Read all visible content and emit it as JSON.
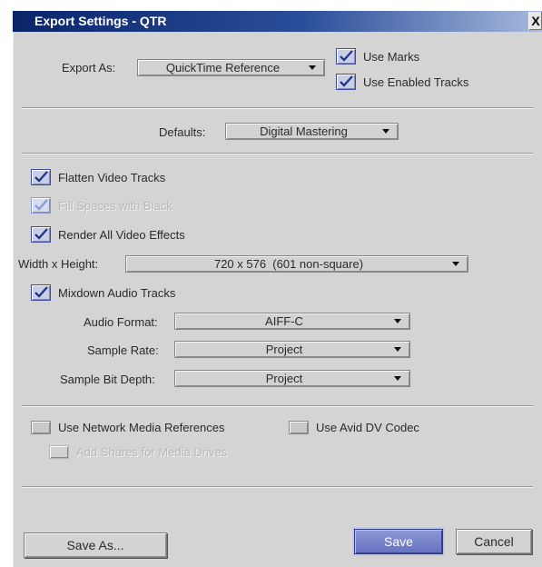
{
  "window": {
    "title": "Export Settings - QTR",
    "close_label": "X"
  },
  "top": {
    "export_as_label": "Export As:",
    "export_as_value": "QuickTime Reference",
    "use_marks": {
      "label": "Use Marks",
      "checked": true
    },
    "use_enabled_tracks": {
      "label": "Use Enabled Tracks",
      "checked": true
    }
  },
  "defaults": {
    "label": "Defaults:",
    "value": "Digital Mastering"
  },
  "video": {
    "flatten": {
      "label": "Flatten Video Tracks",
      "checked": true
    },
    "fill_spaces": {
      "label": "Fill Spaces with Black",
      "checked": true,
      "enabled": false
    },
    "render_effects": {
      "label": "Render All Video Effects",
      "checked": true
    },
    "size_label": "Width x Height:",
    "size_value": "720 x 576  (601 non-square)"
  },
  "audio": {
    "mixdown": {
      "label": "Mixdown Audio Tracks",
      "checked": true
    },
    "format_label": "Audio Format:",
    "format_value": "AIFF-C",
    "rate_label": "Sample Rate:",
    "rate_value": "Project",
    "depth_label": "Sample Bit Depth:",
    "depth_value": "Project"
  },
  "options": {
    "network_refs": {
      "label": "Use Network Media References",
      "checked": false
    },
    "avid_dv": {
      "label": "Use Avid DV Codec",
      "checked": false
    },
    "add_shares": {
      "label": "Add Shares for Media Drives",
      "checked": false,
      "enabled": false
    }
  },
  "buttons": {
    "save_as": "Save As...",
    "save": "Save",
    "cancel": "Cancel"
  }
}
